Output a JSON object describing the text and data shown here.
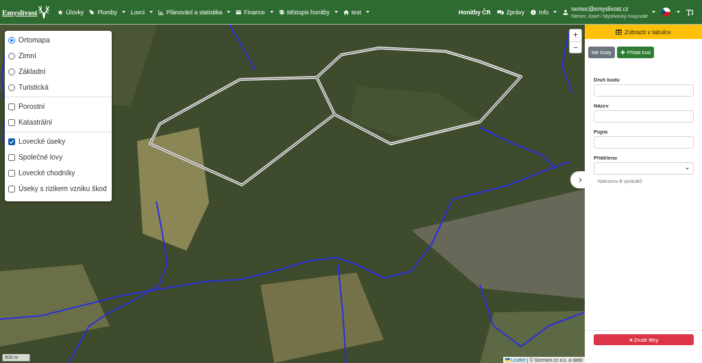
{
  "navbar": {
    "brand": "Emyslivost",
    "menu": [
      {
        "label": "Úlovky",
        "dropdown": false
      },
      {
        "label": "Plomby",
        "dropdown": true
      },
      {
        "label": "Lovci",
        "dropdown": true
      },
      {
        "label": "Plánování a statistika",
        "dropdown": true
      },
      {
        "label": "Finance",
        "dropdown": true
      },
      {
        "label": "Místopis honitby",
        "dropdown": true
      },
      {
        "label": "test",
        "dropdown": true
      }
    ],
    "hunting_grounds_link": "Honitby ČR",
    "right_menu": [
      {
        "label": "Zprávy",
        "dropdown": false
      },
      {
        "label": "Info",
        "dropdown": true
      }
    ],
    "user": {
      "email": "nemec@emyslivost.cz",
      "role": "Němec Josef / Myslivecký hospodář"
    }
  },
  "layers": {
    "base_maps": [
      {
        "label": "Ortomapa",
        "selected": true
      },
      {
        "label": "Zimní",
        "selected": false
      },
      {
        "label": "Základní",
        "selected": false
      },
      {
        "label": "Turistická",
        "selected": false
      }
    ],
    "overlays": [
      {
        "label": "Porostní",
        "checked": false
      },
      {
        "label": "Katastrální",
        "checked": false
      }
    ],
    "hunting_layers": [
      {
        "label": "Lovecké úseky",
        "checked": true
      },
      {
        "label": "Společné lovy",
        "checked": false
      },
      {
        "label": "Lovecké chodníky",
        "checked": false
      },
      {
        "label": "Úseky s rizikem vzniku škod",
        "checked": false
      }
    ]
  },
  "map": {
    "zoom_in": "+",
    "zoom_out": "−",
    "scale": "500 m",
    "attribution": {
      "link": "Leaflet",
      "text": "| © Seznam.cz a.s. a další"
    }
  },
  "side_panel": {
    "table_button": "Zobrazit v tabulce",
    "buttons": [
      {
        "label": "Mé body",
        "kind": "secondary"
      },
      {
        "label": "Přidat bod",
        "kind": "add"
      }
    ],
    "fields": [
      {
        "label": "Druh bodu",
        "kind": "text"
      },
      {
        "label": "Název",
        "kind": "text"
      },
      {
        "label": "Popis",
        "kind": "text"
      },
      {
        "label": "Přiděleno",
        "kind": "select"
      }
    ],
    "result_note": "Nalezeno **0** výsledků",
    "clear_button": "Zrušit filtry"
  }
}
